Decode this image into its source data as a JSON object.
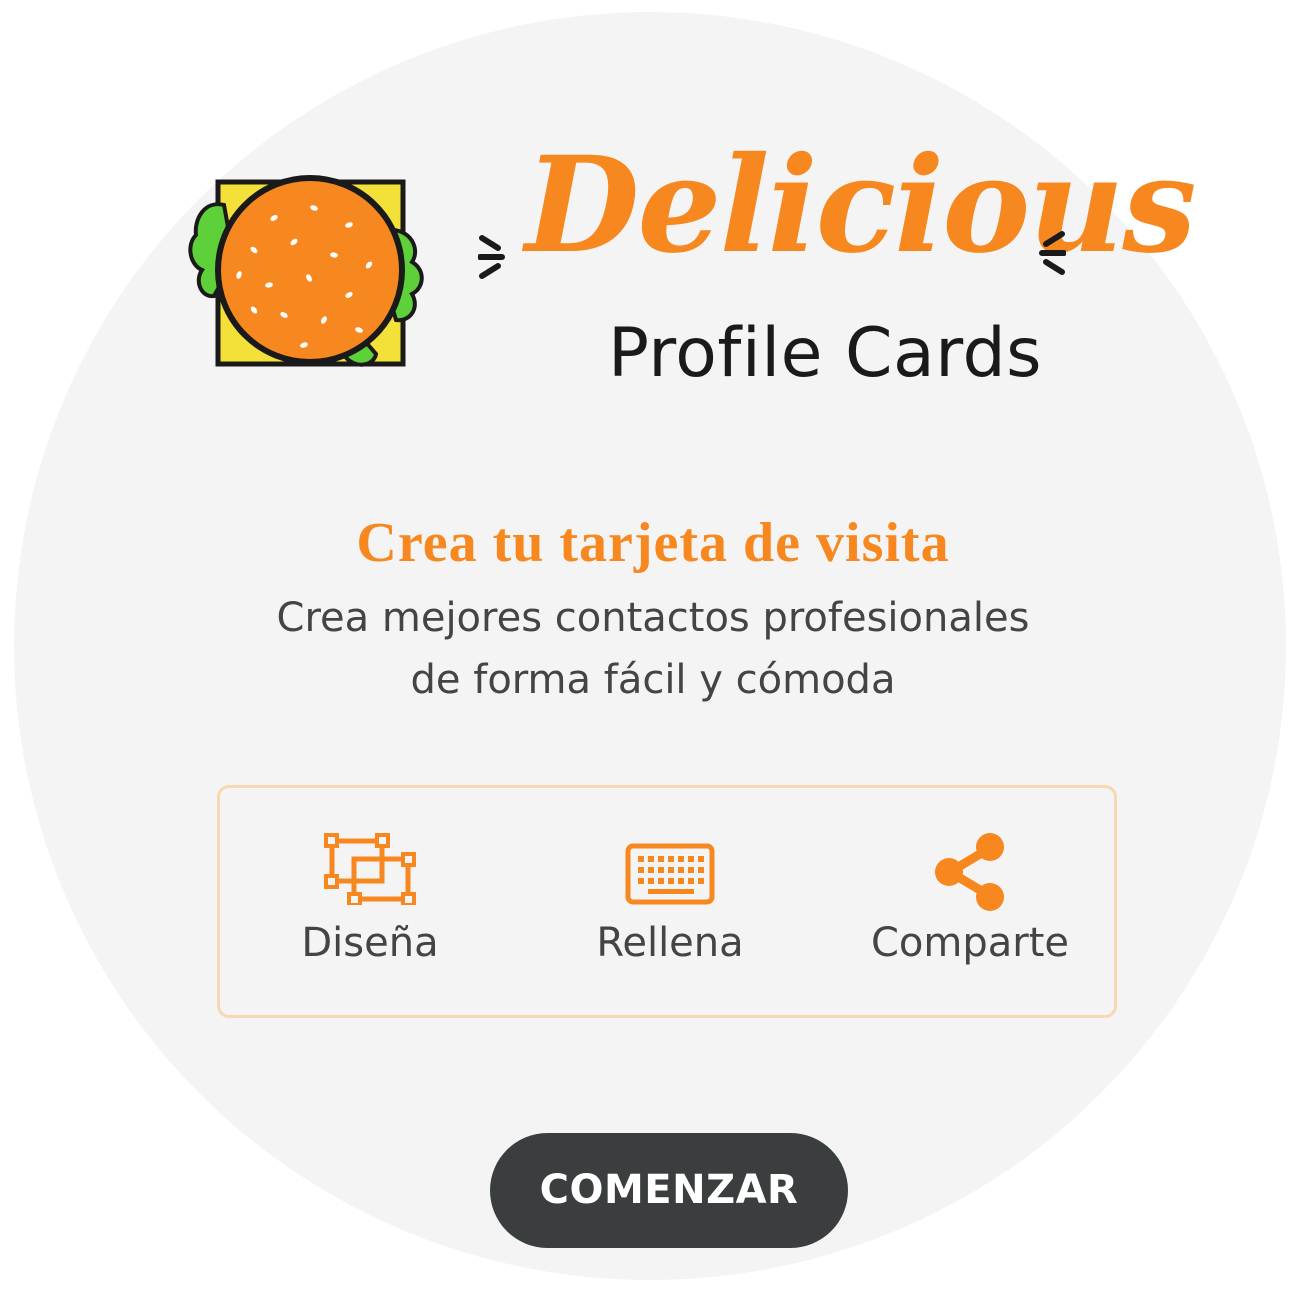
{
  "logo": {
    "script_text": "Delicious",
    "sub_text": "Profile Cards",
    "icon": "burger-icon"
  },
  "hero": {
    "headline": "Crea tu tarjeta de visita",
    "line1": "Crea mejores contactos profesionales",
    "line2": "de forma fácil y cómoda"
  },
  "steps": [
    {
      "label": "Diseña",
      "icon": "design-icon"
    },
    {
      "label": "Rellena",
      "icon": "keyboard-icon"
    },
    {
      "label": "Comparte",
      "icon": "share-icon"
    }
  ],
  "cta": {
    "label": "COMENZAR"
  },
  "colors": {
    "accent": "#f7881f",
    "background": "#f4f4f4",
    "button": "#3a3e3f",
    "text": "#444444",
    "border": "#f8d7b3"
  }
}
